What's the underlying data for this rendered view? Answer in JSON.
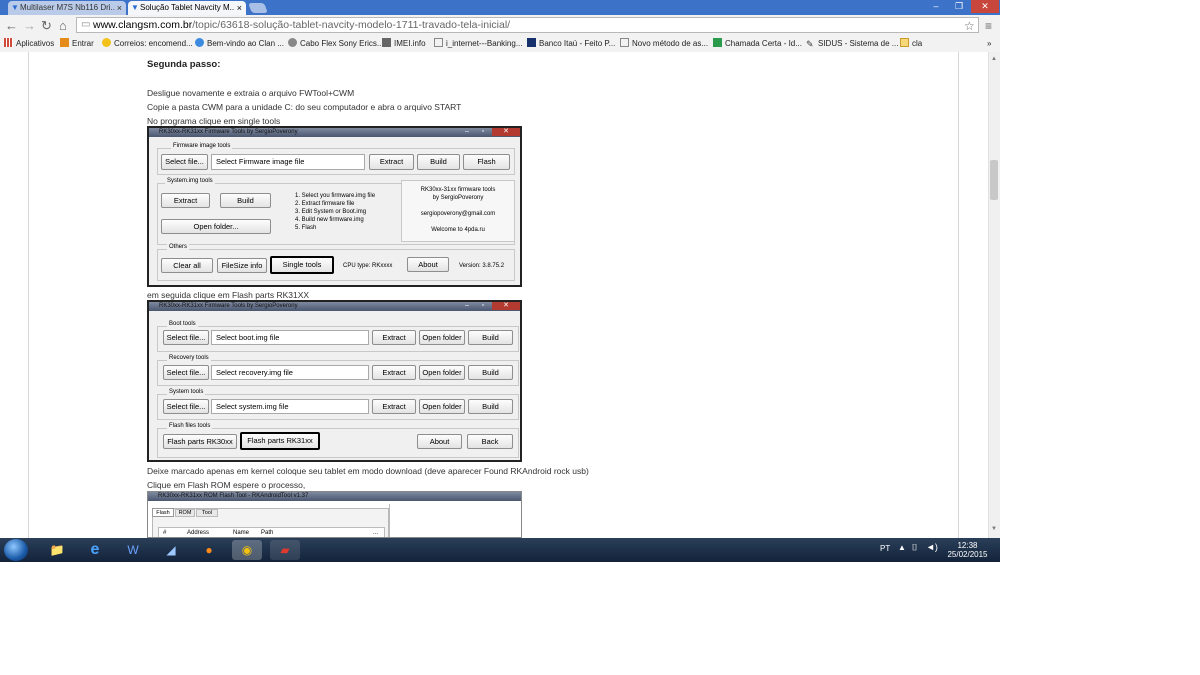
{
  "browser": {
    "tabs": [
      {
        "label": "Multilaser M7S Nb116 Dri..",
        "active": false
      },
      {
        "label": "Solução Tablet Navcity M..",
        "active": true
      }
    ],
    "address": {
      "host": "www.clangsm.com.br",
      "path": "/topic/63618-solução-tablet-navcity-modelo-1711-travado-tela-inicial/"
    },
    "bookmarks": [
      {
        "label": "Aplicativos",
        "icon": "apps-grid-icon"
      },
      {
        "label": "Entrar",
        "icon": "bookmark-favicon"
      },
      {
        "label": "Correios: encomend...",
        "icon": "bookmark-favicon"
      },
      {
        "label": "Bem-vindo ao Clan ...",
        "icon": "bookmark-favicon"
      },
      {
        "label": "Cabo Flex Sony Erics...",
        "icon": "bookmark-favicon"
      },
      {
        "label": "IMEI.info",
        "icon": "bookmark-favicon"
      },
      {
        "label": "i_internet---Banking...",
        "icon": "page-icon"
      },
      {
        "label": "Banco Itaú - Feito P...",
        "icon": "bookmark-favicon"
      },
      {
        "label": "Novo método de as...",
        "icon": "page-icon"
      },
      {
        "label": "Chamada Certa - Id...",
        "icon": "bookmark-favicon"
      },
      {
        "label": "SIDUS - Sistema de ...",
        "icon": "bookmark-favicon"
      },
      {
        "label": "cla",
        "icon": "folder-icon"
      }
    ],
    "bookmarks_more": "»"
  },
  "post": {
    "heading": "Segunda passo:",
    "line1": "Desligue novamente e extraia o arquivo FWTool+CWM",
    "line2": "Copie a pasta CWM para a unidade C: do seu computador e abra o arquivo START",
    "line3": "No programa clique em single tools",
    "line4": "em seguida clique em Flash parts RK31XX",
    "line5": "Deixe marcado apenas em kernel coloque seu tablet em modo download (deve aparecer Found RKAndroid rock usb)",
    "line6": "Clique em Flash ROM espere o processo,"
  },
  "tool1": {
    "title": "RK30xx-RK31xx Firmware Tools by SergioPoverony",
    "firmware_group": "Firmware image tools",
    "select_file": "Select file...",
    "firmware_field": "Select Firmware image file",
    "extract": "Extract",
    "build": "Build",
    "flash": "Flash",
    "system_group": "System.img tools",
    "open_folder": "Open folder...",
    "steps": [
      "1. Select you firmware.img file",
      "2. Extract firmware file",
      "3. Edit System or Boot.img",
      "4. Build new firmware.img",
      "5. Flash"
    ],
    "info_title1": "RK30xx-31xx firmware tools",
    "info_title2": "by SergioPoverony",
    "info_email": "sergiopoverony@gmail.com",
    "info_welcome": "Welcome to 4pda.ru",
    "others_group": "Others",
    "clear_all": "Clear all",
    "filesize": "FileSize info",
    "single_tools": "Single tools",
    "cpu_type": "CPU type: RKxxxx",
    "about": "About",
    "version": "Version: 3.8.75.2"
  },
  "tool2": {
    "title": "RK30xx-RK31xx Firmware Tools by SergioPoverony",
    "boot_group": "Boot tools",
    "recovery_group": "Recovery tools",
    "system_group": "System tools",
    "flash_group": "Flash files tools",
    "select_file": "Select file...",
    "boot_field": "Select boot.img file",
    "recovery_field": "Select recovery.img file",
    "system_field": "Select system.img file",
    "extract": "Extract",
    "open_folder": "Open folder",
    "build": "Build",
    "flash30": "Flash parts RK30xx",
    "flash31": "Flash parts RK31xx",
    "about": "About",
    "back": "Back"
  },
  "tool3": {
    "title": "RK30xx-RK31xx ROM Flash Tool - RKAndroidTool v1.37",
    "tabs": [
      "Flash",
      "ROM",
      "Tool"
    ],
    "col_check": "#",
    "col_address": "Address",
    "col_name": "Name",
    "col_path": "Path",
    "col_more": "..."
  },
  "taskbar": {
    "lang": "PT",
    "time": "12:38",
    "date": "25/02/2015"
  },
  "colors": {
    "tabbar": "#3c72c7",
    "taskbar": "#1c2e48"
  }
}
